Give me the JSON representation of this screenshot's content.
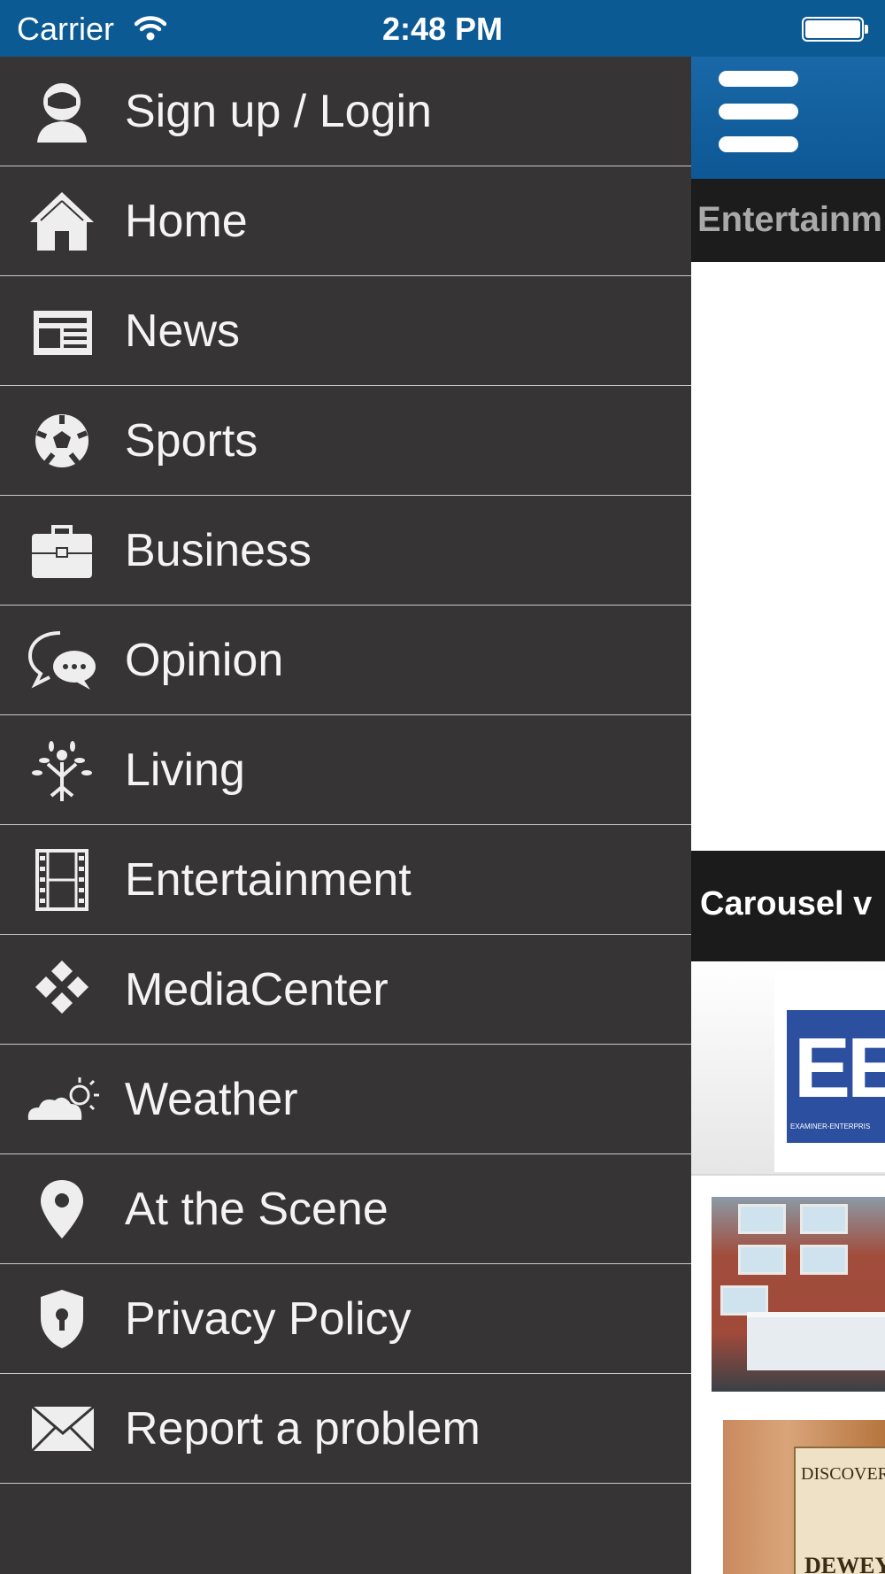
{
  "status_bar": {
    "carrier": "Carrier",
    "time": "2:48 PM"
  },
  "menu": {
    "items": [
      {
        "label": "Sign up / Login",
        "icon": "user-icon"
      },
      {
        "label": "Home",
        "icon": "home-icon"
      },
      {
        "label": "News",
        "icon": "newspaper-icon"
      },
      {
        "label": "Sports",
        "icon": "soccer-ball-icon"
      },
      {
        "label": "Business",
        "icon": "briefcase-icon"
      },
      {
        "label": "Opinion",
        "icon": "chat-bubbles-icon"
      },
      {
        "label": "Living",
        "icon": "tree-person-icon"
      },
      {
        "label": "Entertainment",
        "icon": "film-strip-icon"
      },
      {
        "label": "MediaCenter",
        "icon": "diamond-grid-icon"
      },
      {
        "label": "Weather",
        "icon": "cloud-sun-icon"
      },
      {
        "label": "At the Scene",
        "icon": "map-pin-icon"
      },
      {
        "label": "Privacy Policy",
        "icon": "shield-lock-icon"
      },
      {
        "label": "Report a problem",
        "icon": "envelope-icon"
      }
    ]
  },
  "content": {
    "section_label": "Entertainm",
    "carousel_label": "Carousel v",
    "logo_text": "EE",
    "logo_subtext": "EXAMINER-ENTERPRIS",
    "sign_text_top": "DISCOVER",
    "sign_text_bottom": "DEWEY"
  },
  "colors": {
    "drawer_bg": "#373435",
    "status_bar": "#0c5a94",
    "header": "#1a68a8"
  }
}
